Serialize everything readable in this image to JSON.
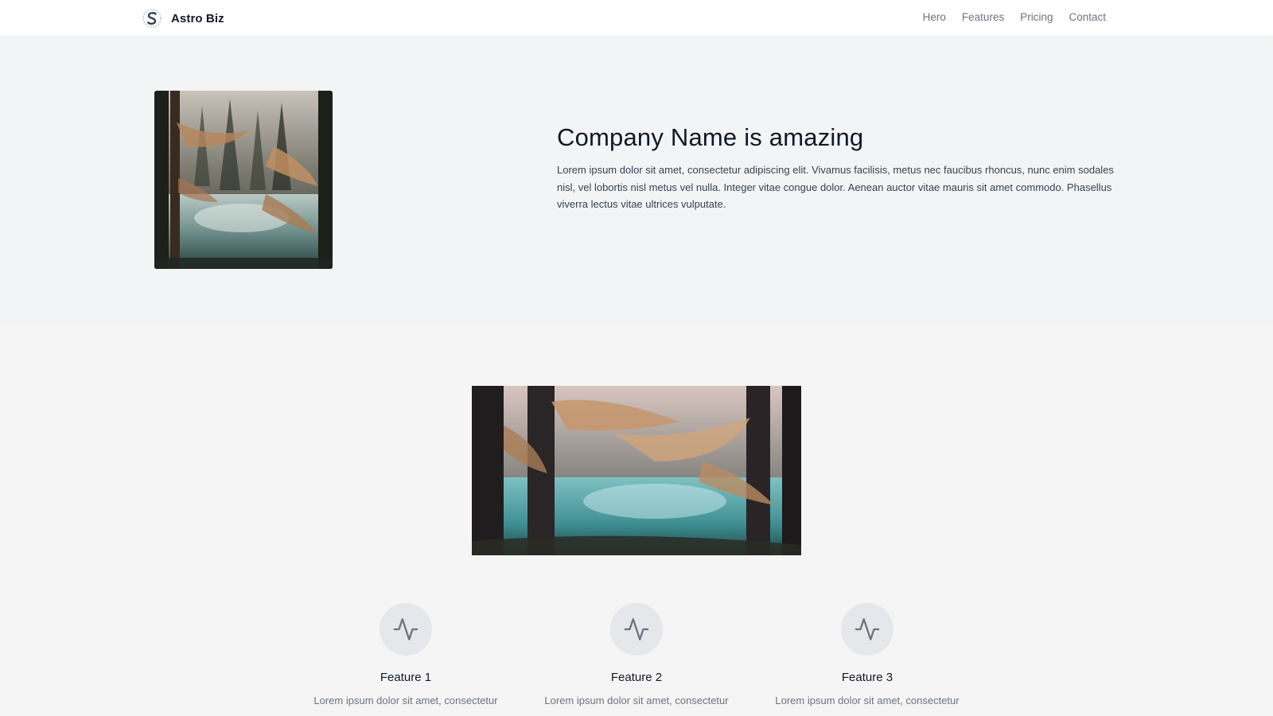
{
  "header": {
    "brand_name": "Astro Biz",
    "logo_icon": "brand-s-logo",
    "nav": [
      {
        "label": "Hero"
      },
      {
        "label": "Features"
      },
      {
        "label": "Pricing"
      },
      {
        "label": "Contact"
      }
    ]
  },
  "hero": {
    "title": "Company Name is amazing",
    "body": "Lorem ipsum dolor sit amet, consectetur adipiscing elit. Vivamus facilisis, metus nec faucibus rhoncus, nunc enim sodales nisl, vel lobortis nisl metus vel nulla. Integer vitae congue dolor. Aenean auctor vitae mauris sit amet commodo. Phasellus viverra lectus vitae ultrices vulputate."
  },
  "features": {
    "items": [
      {
        "title": "Feature 1",
        "desc": "Lorem ipsum dolor sit amet, consectetur",
        "icon": "activity-icon"
      },
      {
        "title": "Feature 2",
        "desc": "Lorem ipsum dolor sit amet, consectetur",
        "icon": "activity-icon"
      },
      {
        "title": "Feature 3",
        "desc": "Lorem ipsum dolor sit amet, consectetur",
        "icon": "activity-icon"
      }
    ]
  },
  "colors": {
    "page_bg": "#f3f4f6",
    "header_bg": "#ffffff",
    "nav_text": "#6b7280",
    "icon_circle": "#e5e7eb",
    "icon_stroke": "#6b7280"
  }
}
